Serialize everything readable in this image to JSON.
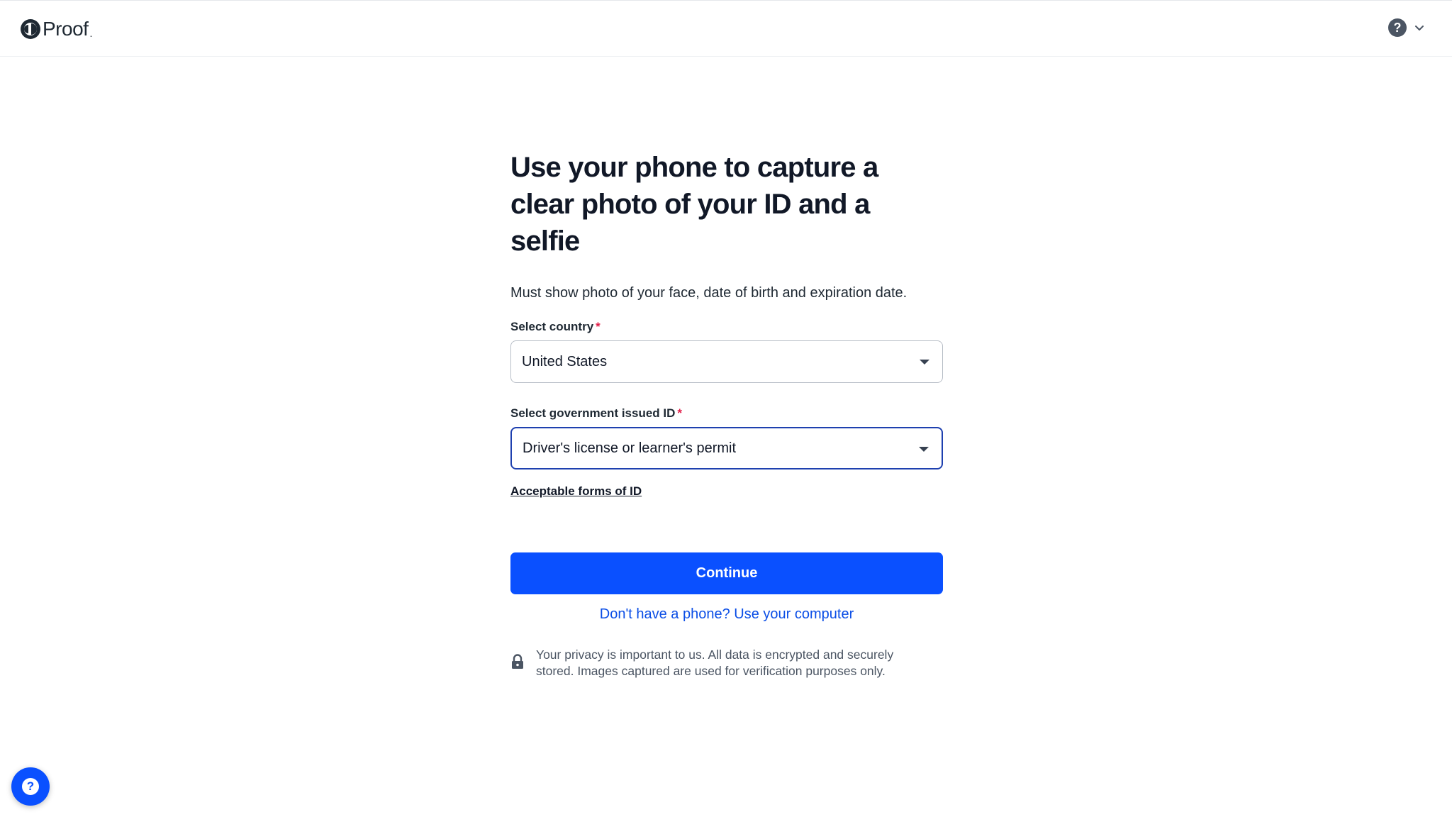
{
  "header": {
    "logo_text": "Proof",
    "logo_suffix": ".",
    "help_glyph": "?",
    "help_icon": "help-circle-icon",
    "chevron_icon": "chevron-down-icon"
  },
  "main": {
    "title": "Use your phone to capture a clear photo of your ID and a selfie",
    "subtitle": "Must show photo of your face, date of birth and expiration date.",
    "country_field": {
      "label": "Select country",
      "required_mark": "*",
      "value": "United States"
    },
    "id_field": {
      "label": "Select government issued ID",
      "required_mark": "*",
      "value": "Driver's license or learner's permit"
    },
    "acceptable_link": "Acceptable forms of ID",
    "continue_label": "Continue",
    "alt_link": "Don't have a phone? Use your computer",
    "privacy_text": "Your privacy is important to us. All data is encrypted and securely stored. Images captured are used for verification purposes only."
  },
  "support_widget": {
    "glyph": "?",
    "icon": "help-chat-icon"
  },
  "colors": {
    "primary": "#0a50ff",
    "link": "#0b4ee6",
    "required": "#e11d48",
    "focus_border": "#1e40af"
  }
}
